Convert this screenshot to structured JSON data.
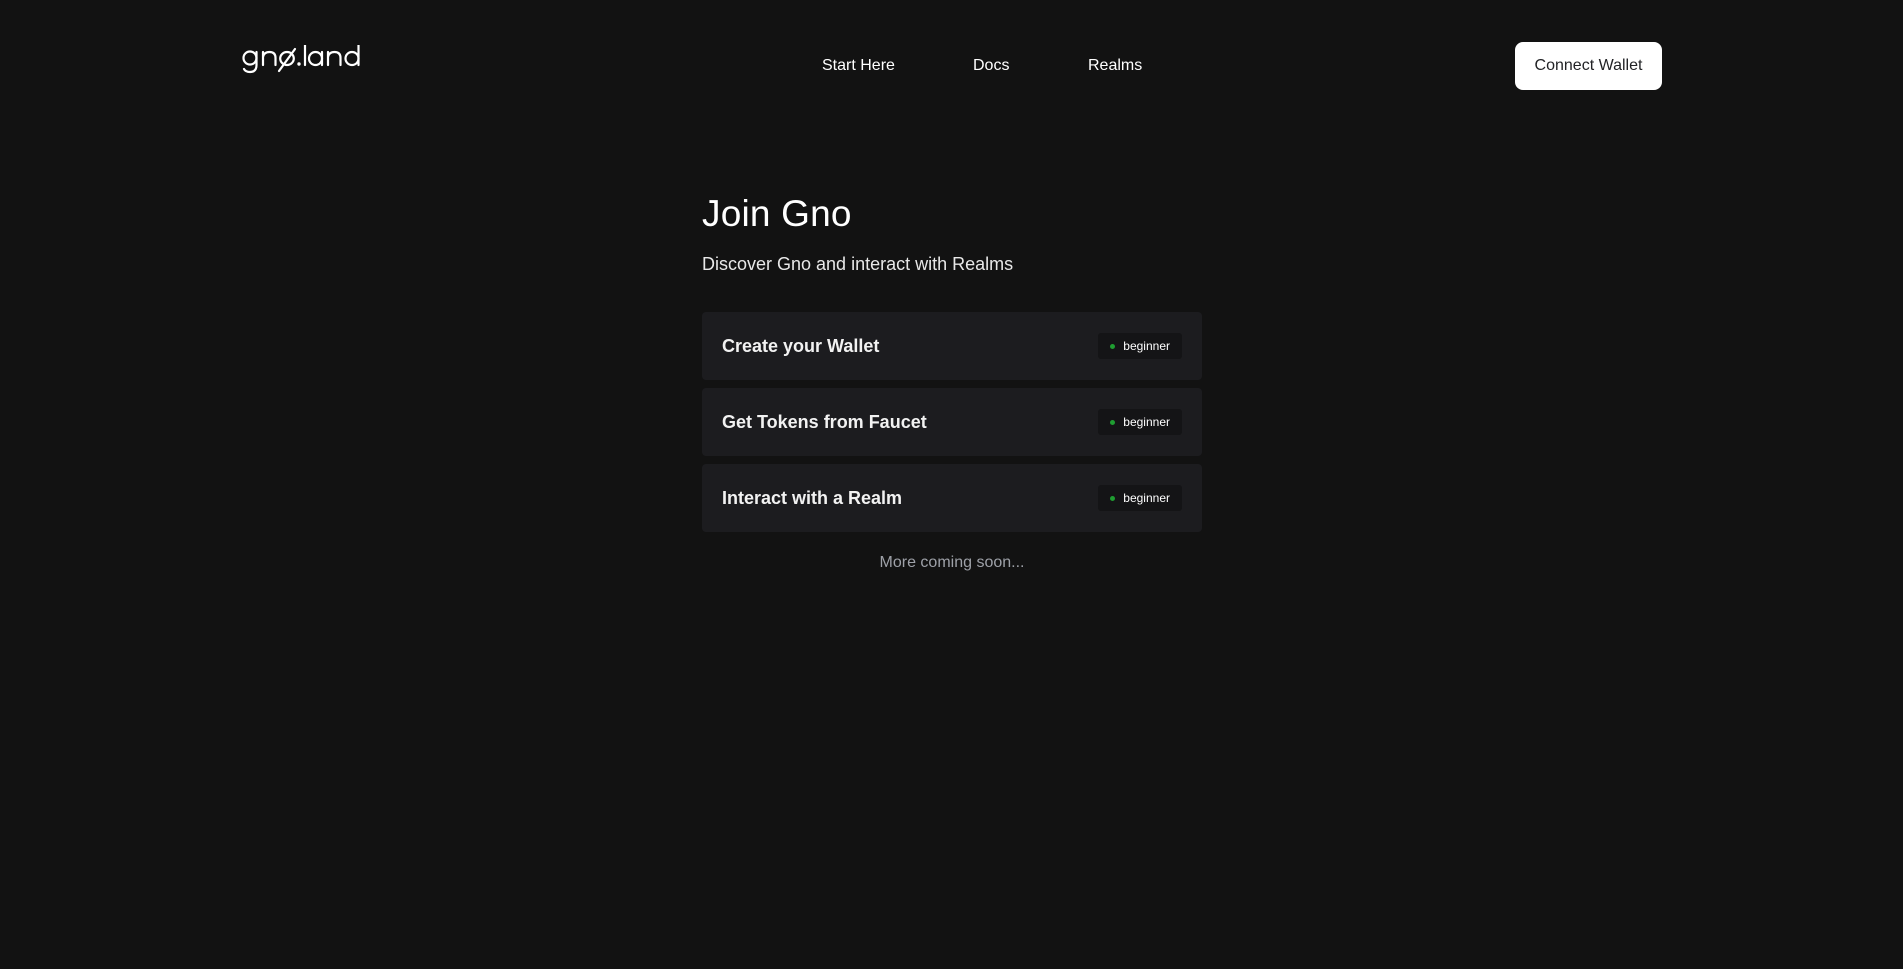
{
  "header": {
    "logo_text": "gno.land",
    "logo_icon": "gno-land-logo",
    "nav": [
      {
        "label": "Start Here"
      },
      {
        "label": "Docs"
      },
      {
        "label": "Realms"
      }
    ],
    "connect_wallet_label": "Connect Wallet"
  },
  "main": {
    "title": "Join Gno",
    "subtitle": "Discover Gno and interact with Realms",
    "tutorials": [
      {
        "title": "Create your Wallet",
        "level": "beginner"
      },
      {
        "title": "Get Tokens from Faucet",
        "level": "beginner"
      },
      {
        "title": "Interact with a Realm",
        "level": "beginner"
      }
    ],
    "footer_note": "More coming soon..."
  },
  "colors": {
    "background": "#121212",
    "card": "#1c1c1f",
    "badge_bg": "#141416",
    "badge_dot": "#1f9d31",
    "button_bg": "#ffffff",
    "muted_text": "#9ea1a8"
  }
}
